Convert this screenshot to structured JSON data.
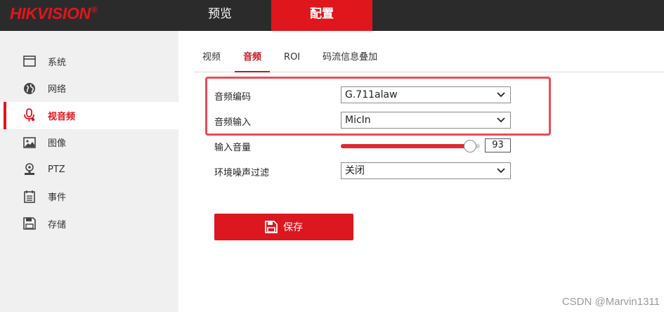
{
  "brand": {
    "logo_text": "HIKVISION",
    "logo_mark": "®",
    "accent": "#e0161d"
  },
  "topnav": {
    "preview_label": "预览",
    "config_label": "配置"
  },
  "sidebar": {
    "active_index": 2,
    "items": [
      {
        "label": "系统",
        "icon": "window-icon"
      },
      {
        "label": "网络",
        "icon": "globe-icon"
      },
      {
        "label": "视音频",
        "icon": "microphone-icon"
      },
      {
        "label": "图像",
        "icon": "image-icon"
      },
      {
        "label": "PTZ",
        "icon": "ptz-icon"
      },
      {
        "label": "事件",
        "icon": "calendar-icon"
      },
      {
        "label": "存储",
        "icon": "floppy-icon"
      }
    ]
  },
  "subtabs": [
    {
      "label": "视频",
      "active": false
    },
    {
      "label": "音频",
      "active": true
    },
    {
      "label": "ROI",
      "active": false
    },
    {
      "label": "码流信息叠加",
      "active": false
    }
  ],
  "form": {
    "audio_encoding": {
      "label": "音频编码",
      "value": "G.711alaw"
    },
    "audio_input": {
      "label": "音频输入",
      "value": "MicIn"
    },
    "input_volume": {
      "label": "输入音量",
      "value": "93",
      "max": 100,
      "fraction": 0.93
    },
    "noise_filter": {
      "label": "环境噪声过滤",
      "value": "关闭"
    }
  },
  "save_button": {
    "label": "保存"
  },
  "watermark": "CSDN @Marvin1311"
}
